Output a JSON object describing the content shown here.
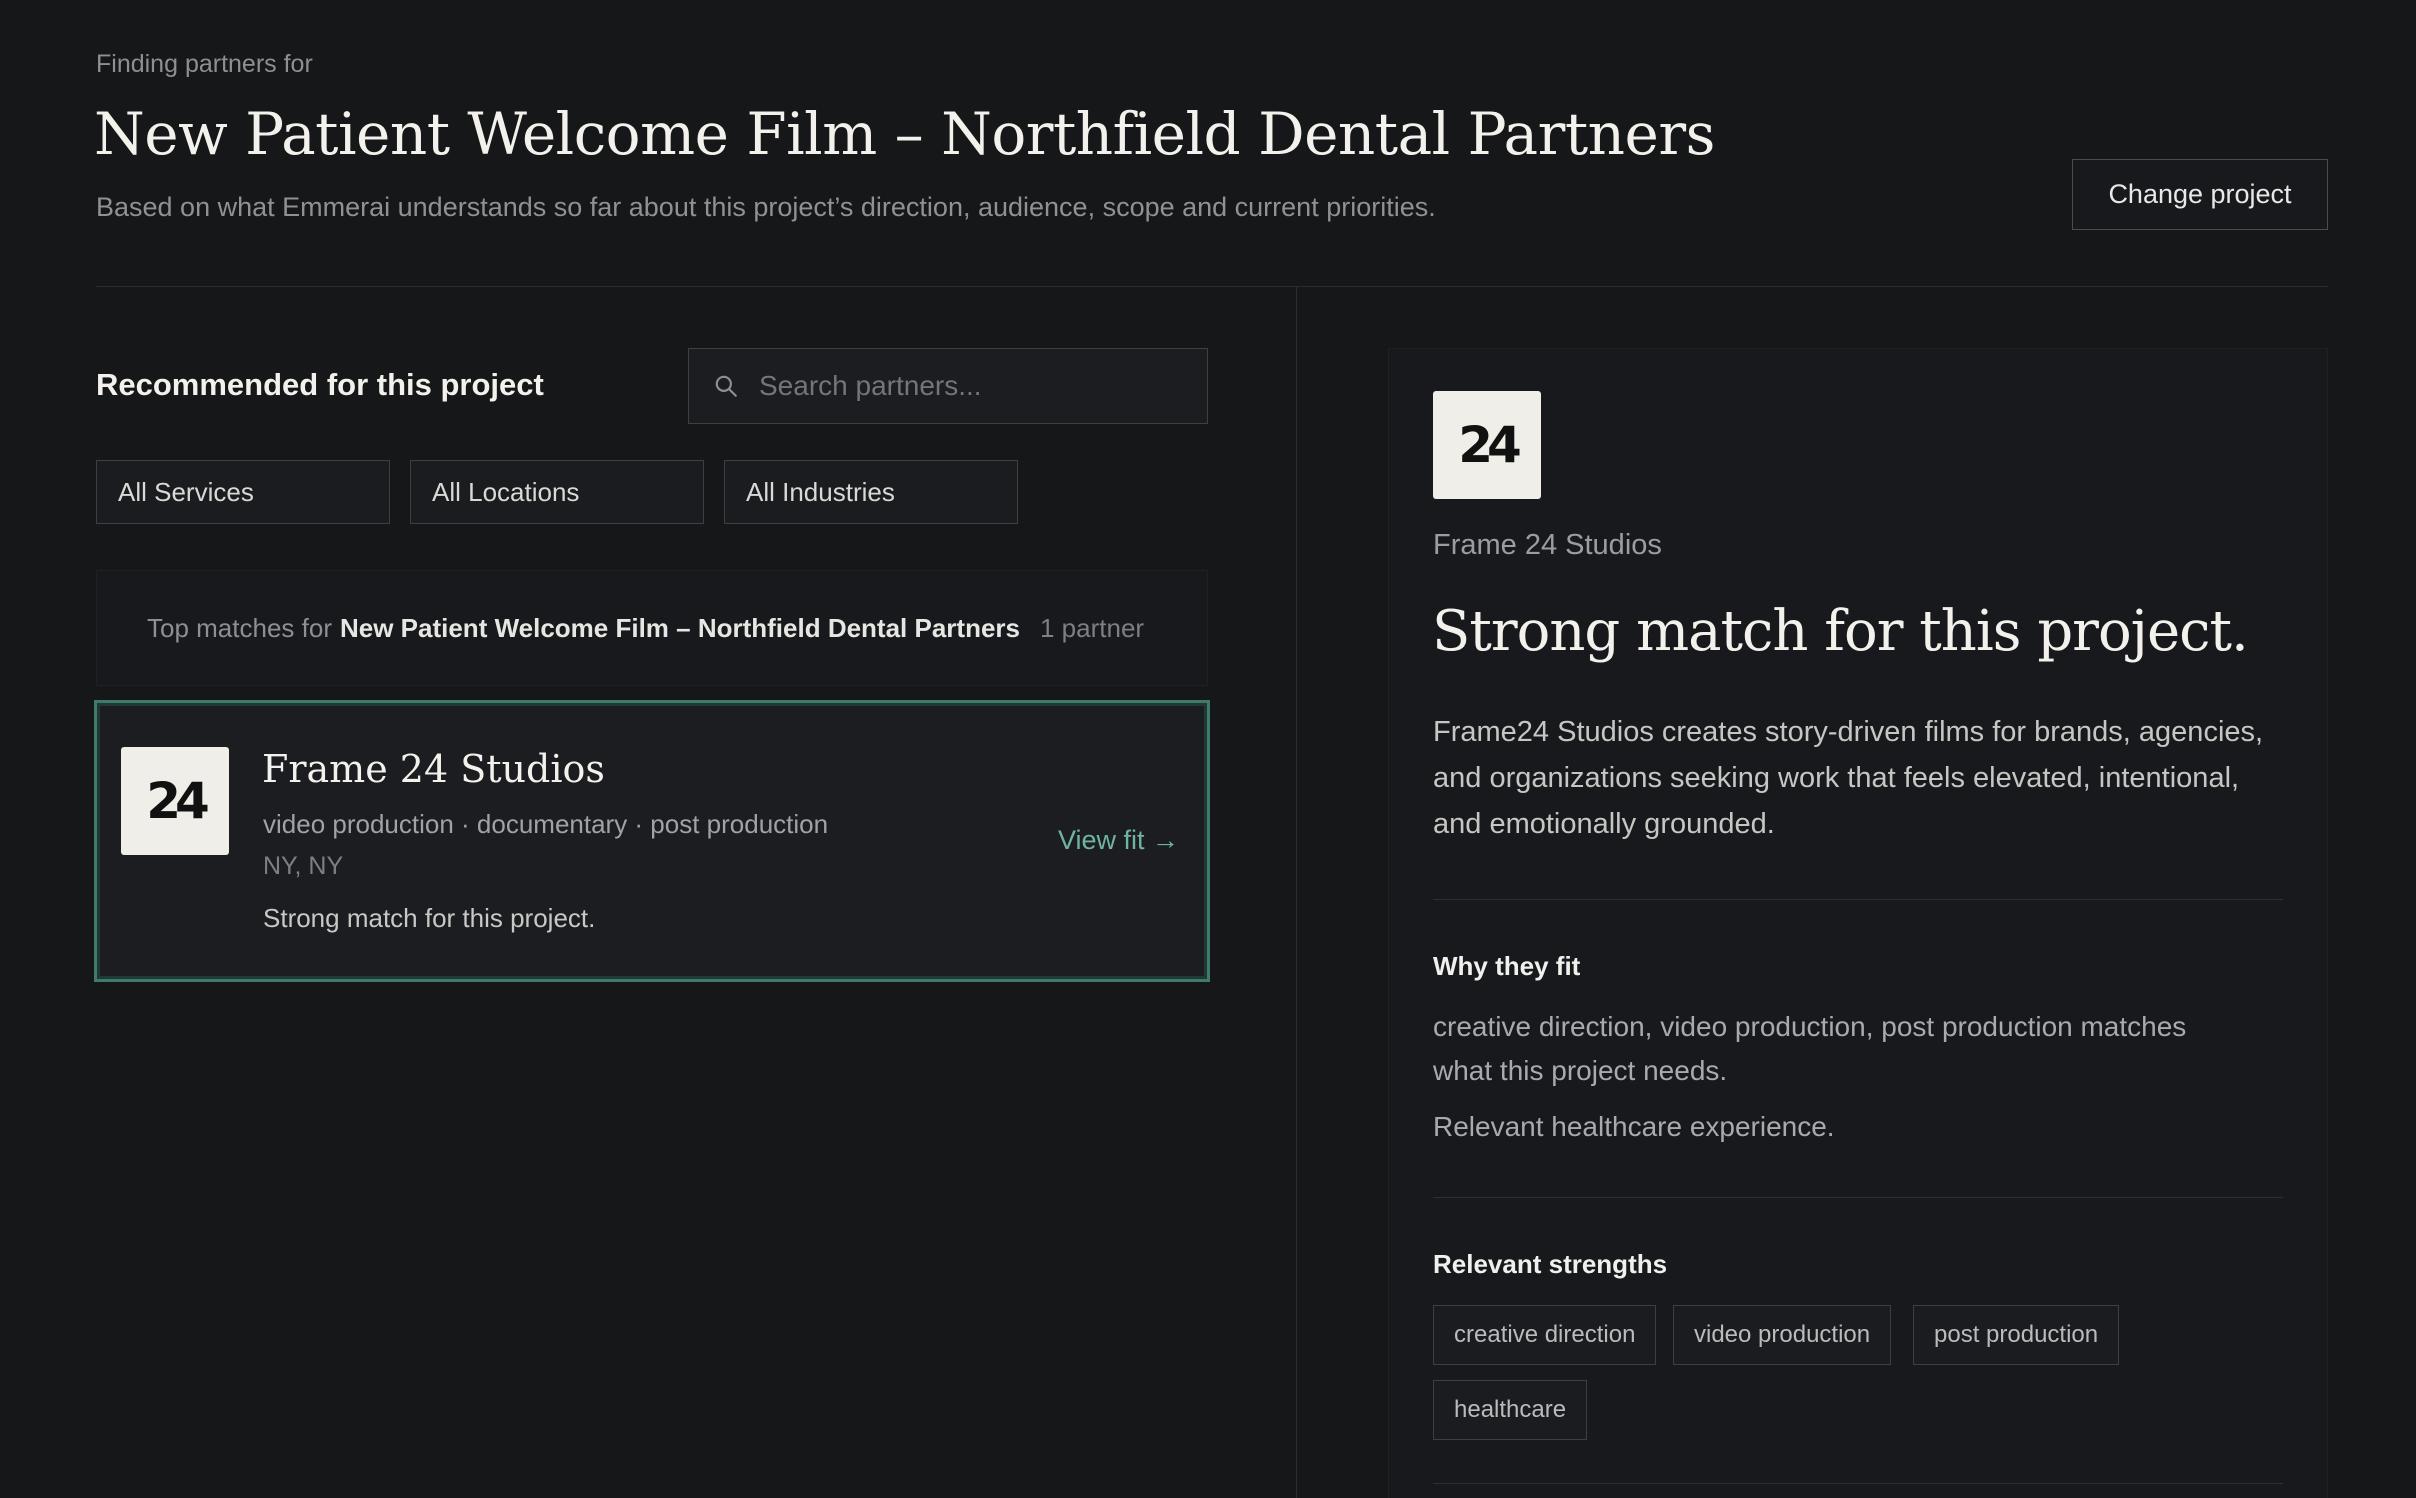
{
  "header": {
    "eyebrow": "Finding partners for",
    "project_title": "New Patient Welcome Film – Northfield Dental Partners",
    "subtitle": "Based on what Emmerai understands so far about this project’s direction, audience, scope and current priorities.",
    "change_project_label": "Change project"
  },
  "left": {
    "section_title": "Recommended for this project",
    "search": {
      "placeholder": "Search partners...",
      "value": "",
      "icon": "search-icon"
    },
    "filters": [
      "All Services",
      "All Locations",
      "All Industries"
    ],
    "matches": {
      "prefix": "Top matches for",
      "project": "New Patient Welcome Film – Northfield Dental Partners",
      "count": "1 partner"
    },
    "partner": {
      "logo_text": "24",
      "name": "Frame 24 Studios",
      "services": "video production · documentary · post production",
      "location": "NY, NY",
      "summary": "Strong match for this project.",
      "view_fit": "View fit →"
    }
  },
  "detail": {
    "logo_text": "24",
    "name": "Frame 24 Studios",
    "headline": "Strong match for this project.",
    "description": "Frame24 Studios creates story-driven films for brands, agencies, and organizations seeking work that feels elevated, intentional, and emotionally grounded.",
    "why_heading": "Why they fit",
    "why_text": "creative direction, video production, post production matches what this project needs.",
    "why_extra": "Relevant healthcare experience.",
    "strengths_heading": "Relevant strengths",
    "strengths": [
      "creative direction",
      "video production",
      "post production",
      "healthcare"
    ]
  },
  "colors": {
    "background": "#151719",
    "accent": "#6fb3a1",
    "selected_border": "#3f7a6c",
    "logo_bg": "#efeee8"
  }
}
